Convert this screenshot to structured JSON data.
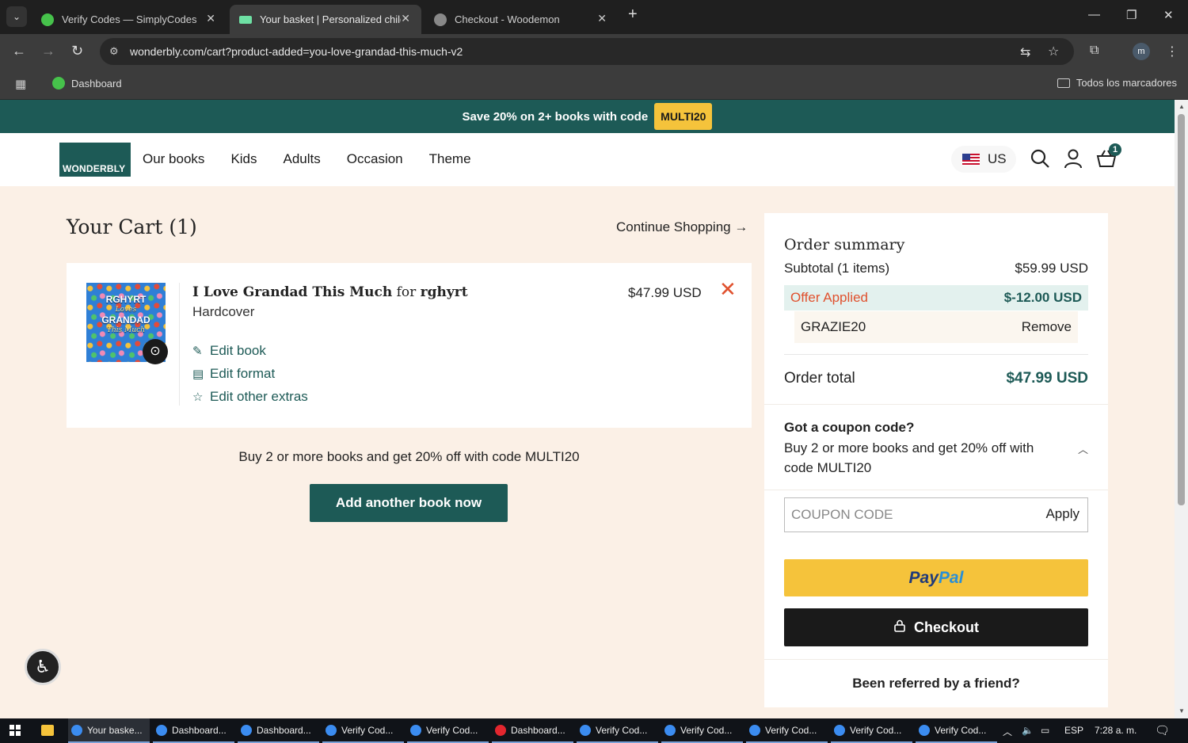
{
  "browser": {
    "tabs": [
      {
        "label": "Verify Codes — SimplyCodes",
        "active": false
      },
      {
        "label": "Your basket | Personalized child",
        "active": true
      },
      {
        "label": "Checkout - Woodemon",
        "active": false
      }
    ],
    "url": "wonderbly.com/cart?product-added=you-love-grandad-this-much-v2",
    "bookmarks": {
      "item": "Dashboard",
      "all": "Todos los marcadores"
    },
    "profile_initial": "m"
  },
  "promo": {
    "text": "Save 20% on 2+ books with code",
    "code": "MULTI20"
  },
  "header": {
    "logo": "WONDERBLY",
    "nav": [
      "Our books",
      "Kids",
      "Adults",
      "Occasion",
      "Theme"
    ],
    "locale": "US",
    "cart_count": "1"
  },
  "cart": {
    "title": "Your Cart (1)",
    "continue": "Continue Shopping →",
    "item": {
      "cover_lines": [
        "RGHYRT",
        "Loves",
        "GRANDAD",
        "This Much"
      ],
      "name_bold_1": "I Love Grandad This Much",
      "name_mid": "for",
      "name_bold_2": "rghyrt",
      "format": "Hardcover",
      "price": "$47.99 USD",
      "edit_book": "Edit book",
      "edit_format": "Edit format",
      "edit_extras": "Edit other extras"
    },
    "multi_text": "Buy 2 or more books and get 20% off with code MULTI20",
    "add_button": "Add another book now"
  },
  "summary": {
    "title": "Order summary",
    "subtotal_label": "Subtotal (1 items)",
    "subtotal_value": "$59.99 USD",
    "offer_label": "Offer Applied",
    "offer_value": "$-12.00 USD",
    "applied_code": "GRAZIE20",
    "remove": "Remove",
    "total_label": "Order total",
    "total_value": "$47.99 USD",
    "coupon_title": "Got a coupon code?",
    "coupon_desc": "Buy 2 or more books and get 20% off with code MULTI20",
    "coupon_placeholder": "COUPON CODE",
    "apply": "Apply",
    "paypal_1": "Pay",
    "paypal_2": "Pal",
    "checkout": "Checkout",
    "referred": "Been referred by a friend?"
  },
  "taskbar": {
    "tasks": [
      {
        "label": "Your baske...",
        "browser": "chrome"
      },
      {
        "label": "Dashboard...",
        "browser": "chrome"
      },
      {
        "label": "Dashboard...",
        "browser": "chrome"
      },
      {
        "label": "Verify Cod...",
        "browser": "chrome"
      },
      {
        "label": "Verify Cod...",
        "browser": "chrome"
      },
      {
        "label": "Dashboard...",
        "browser": "opera"
      },
      {
        "label": "Verify Cod...",
        "browser": "chrome"
      },
      {
        "label": "Verify Cod...",
        "browser": "chrome"
      },
      {
        "label": "Verify Cod...",
        "browser": "chrome"
      },
      {
        "label": "Verify Cod...",
        "browser": "chrome"
      },
      {
        "label": "Verify Cod...",
        "browser": "chrome"
      }
    ],
    "lang": "ESP",
    "time": "7:28 a. m."
  },
  "colors": {
    "brand": "#1d5a56",
    "accent": "#f5c33b",
    "remove": "#e0512e"
  }
}
